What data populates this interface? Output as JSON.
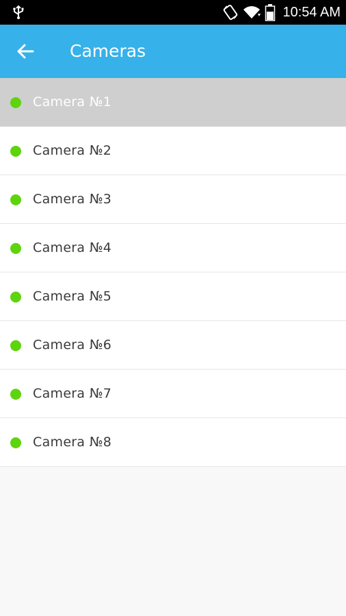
{
  "status_bar": {
    "time": "10:54 AM",
    "icons": [
      "usb-icon",
      "screen-rotation-icon",
      "wifi-icon",
      "battery-icon"
    ]
  },
  "app_bar": {
    "title": "Cameras",
    "back_icon": "arrow-left-icon",
    "color": "#36b1ea"
  },
  "cameras": [
    {
      "label": "Camera №1",
      "status": "online",
      "selected": true
    },
    {
      "label": "Camera №2",
      "status": "online",
      "selected": false
    },
    {
      "label": "Camera №3",
      "status": "online",
      "selected": false
    },
    {
      "label": "Camera №4",
      "status": "online",
      "selected": false
    },
    {
      "label": "Camera №5",
      "status": "online",
      "selected": false
    },
    {
      "label": "Camera №6",
      "status": "online",
      "selected": false
    },
    {
      "label": "Camera №7",
      "status": "online",
      "selected": false
    },
    {
      "label": "Camera №8",
      "status": "online",
      "selected": false
    }
  ],
  "colors": {
    "status_online": "#5ed40e",
    "selected_row": "#cfcfcf"
  }
}
